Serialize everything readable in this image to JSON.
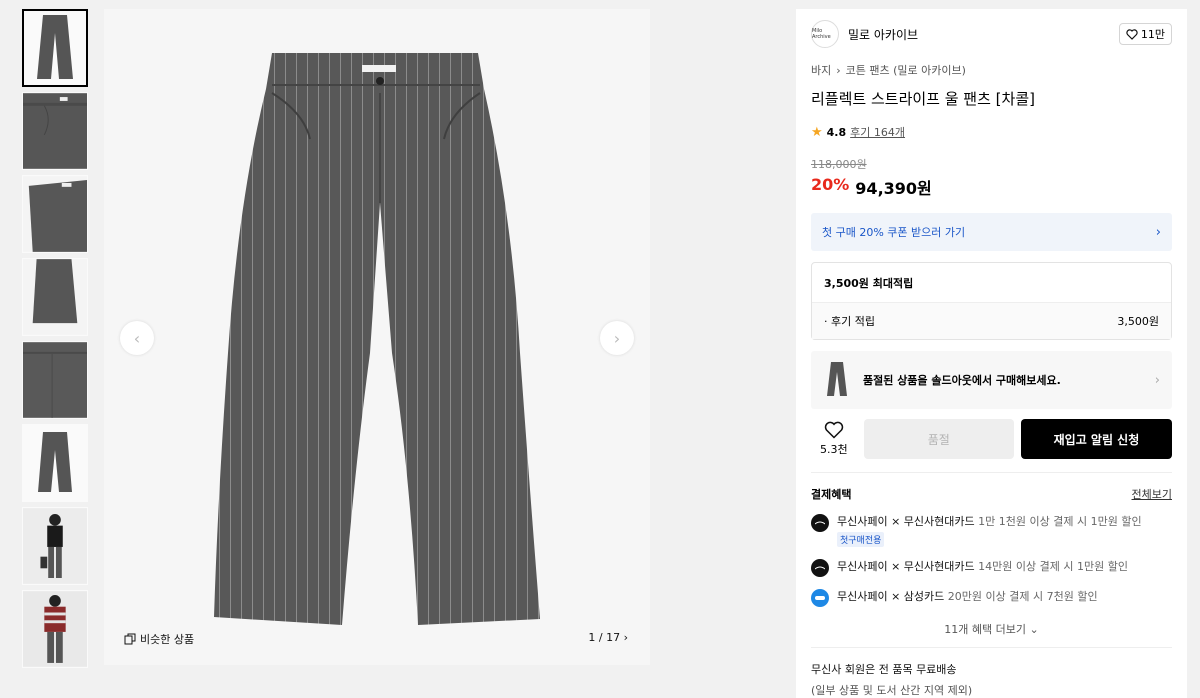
{
  "thumbnails": [
    {
      "name": "pants-front"
    },
    {
      "name": "pants-detail-pocket"
    },
    {
      "name": "pants-detail-waist"
    },
    {
      "name": "pants-detail-hem"
    },
    {
      "name": "pants-detail-back"
    },
    {
      "name": "pants-full"
    },
    {
      "name": "model-front"
    },
    {
      "name": "model-stripe-sweater"
    }
  ],
  "gallery": {
    "similar_label": "비슷한 상품",
    "counter": "1 / 17",
    "prev_icon": "chevron-left-icon",
    "next_icon": "chevron-right-icon"
  },
  "brand": {
    "logo_text": "Milo Archive",
    "name": "밀로 아카이브",
    "likes": "11만"
  },
  "breadcrumb": {
    "category": "바지",
    "subcategory": "코튼 팬츠 (밀로 아카이브)"
  },
  "product": {
    "title": "리플렉트 스트라이프 울 팬츠 [차콜]",
    "rating": "4.8",
    "reviews": "후기 164개",
    "original_price": "118,000원",
    "discount": "20%",
    "price": "94,390원"
  },
  "coupon": {
    "label": "첫 구매 20% 쿠폰 받으러 가기"
  },
  "points": {
    "header": "3,500원 최대적립",
    "row_label": "· 후기 적립",
    "row_value": "3,500원"
  },
  "soldout_banner": {
    "label": "품절된 상품을 솔드아웃에서 구매해보세요."
  },
  "actions": {
    "wish_count": "5.3천",
    "soldout_button": "품절",
    "restock_button": "재입고 알림 신청"
  },
  "payment": {
    "title": "결제혜택",
    "view_all": "전체보기",
    "benefits": [
      {
        "bold": "무신사페이 × 무신사현대카드",
        "rest": " 1만 1천원 이상 결제 시 1만원 할인",
        "tag": "첫구매전용"
      },
      {
        "bold": "무신사페이 × 무신사현대카드",
        "rest": " 14만원 이상 결제 시 1만원 할인"
      },
      {
        "bold": "무신사페이 × 삼성카드",
        "rest": " 20만원 이상 결제 시 7천원 할인"
      }
    ],
    "more": "11개 혜택 더보기"
  },
  "shipping": {
    "line1": "무신사 회원은 전 품목 무료배송",
    "line2": "(일부 상품 및 도서 산간 지역 제외)"
  },
  "colors": {
    "discount_red": "#e8291c",
    "coupon_blue": "#1a56c8",
    "primary_button": "#000000",
    "fabric": "#555555"
  }
}
